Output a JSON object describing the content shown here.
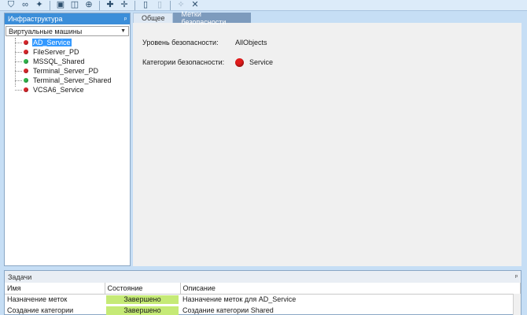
{
  "toolbar": {
    "groups": [
      [
        "shield-icon",
        "connect-icon",
        "pin-icon"
      ],
      [
        "box-open-icon",
        "box-icon",
        "target-icon"
      ],
      [
        "user-plus-icon",
        "user-minus-icon"
      ],
      [
        "device-icon",
        "device-dim-icon"
      ],
      [
        "magic-icon",
        "tools-icon"
      ]
    ]
  },
  "left_pane": {
    "title": "Инфраструктура",
    "pin": "ᵖ",
    "combo_value": "Виртуальные машины",
    "tree": [
      {
        "name": "AD_Service",
        "status": "red",
        "selected": true
      },
      {
        "name": "FileServer_PD",
        "status": "red",
        "selected": false
      },
      {
        "name": "MSSQL_Shared",
        "status": "green",
        "selected": false
      },
      {
        "name": "Terminal_Server_PD",
        "status": "red",
        "selected": false
      },
      {
        "name": "Terminal_Server_Shared",
        "status": "green",
        "selected": false
      },
      {
        "name": "VCSA6_Service",
        "status": "red",
        "selected": false
      }
    ]
  },
  "main": {
    "tabs": [
      {
        "label": "Общее",
        "active": false
      },
      {
        "label": "Метки безопасности",
        "active": true
      }
    ],
    "security_level_label": "Уровень безопасности:",
    "security_level_value": "AllObjects",
    "security_categories_label": "Категории безопасности:",
    "security_category_value": "Service",
    "category_color": "#e11b1b"
  },
  "tasks": {
    "title": "Задачи",
    "pin": "ᵖ",
    "columns": [
      "Имя",
      "Состояние",
      "Описание"
    ],
    "rows": [
      {
        "name": "Назначение меток",
        "state": "Завершено",
        "description": "Назначение меток для AD_Service"
      },
      {
        "name": "Создание категории",
        "state": "Завершено",
        "description": "Создание категории Shared"
      }
    ]
  },
  "colors": {
    "header_blue": "#3b8ed9",
    "selected": "#3399ff",
    "status_done": "#c5ea76",
    "red_dot": "#d7262b",
    "green_dot": "#2fb44a"
  }
}
